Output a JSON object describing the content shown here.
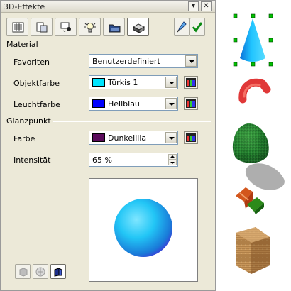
{
  "window": {
    "title": "3D-Effekte",
    "pin_label": "▾",
    "close_label": "✕"
  },
  "toolbar": {
    "tabs": [
      {
        "icon": "geometry-icon"
      },
      {
        "icon": "shading-icon"
      },
      {
        "icon": "lighting-icon"
      },
      {
        "icon": "illumination-icon"
      },
      {
        "icon": "textures-icon"
      },
      {
        "icon": "material-icon",
        "active": true
      }
    ],
    "assign_icon": "eyedropper-icon",
    "apply_icon": "checkmark-icon"
  },
  "material": {
    "section_label": "Material",
    "favoriten": {
      "label": "Favoriten",
      "value": "Benutzerdefiniert"
    },
    "objektfarbe": {
      "label": "Objektfarbe",
      "value": "Türkis 1",
      "color": "#00e5ff"
    },
    "leuchtfarbe": {
      "label": "Leuchtfarbe",
      "value": "Hellblau",
      "color": "#0000ff"
    }
  },
  "glanzpunkt": {
    "section_label": "Glanzpunkt",
    "farbe": {
      "label": "Farbe",
      "value": "Dunkellila",
      "color": "#5a0a5a"
    },
    "intensitaet": {
      "label": "Intensität",
      "value": "65 %"
    }
  },
  "preview": {
    "sphere_color": "#1ea8f0"
  },
  "bottom_buttons": [
    {
      "icon": "cube-icon"
    },
    {
      "icon": "sphere-icon"
    },
    {
      "icon": "perspective-icon",
      "active": true
    }
  ],
  "colors": {
    "dialog_bg": "#ece9d8",
    "cone": "#2ab8ff",
    "selection_handle": "#00c000"
  }
}
